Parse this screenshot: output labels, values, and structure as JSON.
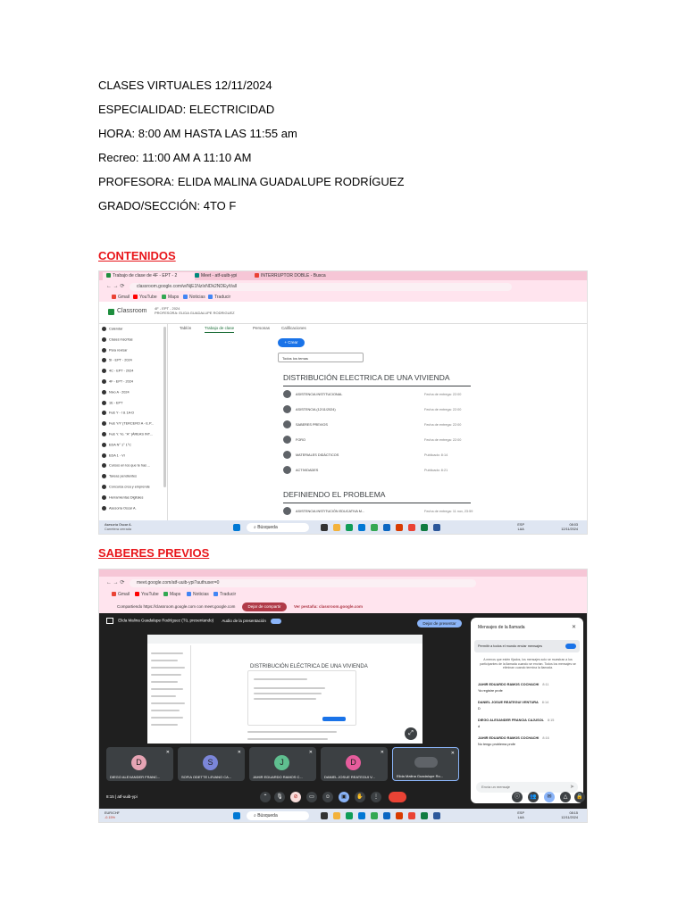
{
  "header": {
    "line1": "CLASES VIRTUALES 12/11/2024",
    "line2": "ESPECIALIDAD: ELECTRICIDAD",
    "line3": "HORA: 8:00 AM HASTA LAS 11:55 am",
    "line4": "Recreo: 11:00 AM A 11:10 AM",
    "line5": "PROFESORA: ELIDA MALINA GUADALUPE RODRÍGUEZ",
    "line6": "GRADO/SECCIÓN: 4TO F"
  },
  "sections": {
    "contenidos": "CONTENIDOS",
    "saberes": "SABERES PREVIOS"
  },
  "colors": {
    "section_heading": "#e8151a",
    "browser_frame": "#ffe4ee",
    "classroom_green": "#1e8e3e",
    "meet_dark": "#1f1f1f",
    "accent_blue": "#1a73e8"
  },
  "classroom": {
    "tabs": [
      "Trabajo de clase de 4F - EPT - 2",
      "Meet - atf-uuib-ypi",
      "INTERRUPTOR DOBLE - Busca"
    ],
    "url": "classroom.google.com/w/NjE1NzIxNDk2NDEy/t/all",
    "bookmarks": [
      "Gmail",
      "YouTube",
      "Maps",
      "Noticias",
      "Traducir"
    ],
    "app_name": "Classroom",
    "course": "4F - EPT - 2024",
    "teacher": "PROFESORA: ELIDA GUADALUPE RODRIGUEZ",
    "sidebar": [
      "Calendar",
      "Clases inscritas",
      "Para revisar",
      "5I - EPT - 2024",
      "4C - EPT - 2024",
      "4F - EPT - 2024",
      "Nivo A - 2024",
      "1E - EPT",
      "Fe& Y - I & 1A-D",
      "Fe& Y/Y (TERCERO A - E.P...",
      "Fe& Y. Yo. \"A\" (ÁREAS INT...",
      "EDA N° 1° 1°C",
      "EDA 1 - VI",
      "Cursos en los que te has ...",
      "Tareas pendientes",
      "Concursa crea y emprende",
      "Herramientas Digitales",
      "Asesoría Oscar A."
    ],
    "content_tabs": [
      "Tablón",
      "Trabajo de clase",
      "Personas",
      "Calificaciones"
    ],
    "create_label": "+ Crear",
    "topic_select": "Todos los temas",
    "topic1_title": "DISTRIBUCIÓN ELECTRICA DE UNA VIVIENDA",
    "topic1_items": [
      {
        "label": "ASISTENCIA INSTITUCIONAL",
        "meta": "Fecha de entrega: 22:00"
      },
      {
        "label": "ASISTENCIA (12/11/2024)",
        "meta": "Fecha de entrega: 22:00"
      },
      {
        "label": "SABERES PREVIOS",
        "meta": "Fecha de entrega: 22:00"
      },
      {
        "label": "FORO",
        "meta": "Fecha de entrega: 22:00"
      },
      {
        "label": "MATERIALES DIDÁCTICOS",
        "meta": "Publicado: 8:14"
      },
      {
        "label": "ACTIVIDADES",
        "meta": "Publicado: 8:21"
      }
    ],
    "topic2_title": "DEFINIENDO EL PROBLEMA",
    "topic2_items": [
      {
        "label": "ASISTENCIA INSTITUCIÓN EDUCATIVA M...",
        "meta": "Fecha de entrega: 11 nov, 23:59"
      }
    ],
    "taskbar": {
      "search": "Búsqueda",
      "lang1": "ESP",
      "lang2": "LAA",
      "time": "08:03",
      "date": "12/11/2024",
      "left_line1": "Asesoría Oscar A.",
      "left_line2": "Carretera cerrada"
    }
  },
  "meet": {
    "url": "meet.google.com/atf-uuib-ypi?authuser=0",
    "bookmarks": [
      "Gmail",
      "YouTube",
      "Maps",
      "Noticias",
      "Traducir"
    ],
    "share_text": "Compartiendo https://classroom.google.com con meet.google.com",
    "stop_share": "Dejar de compartir",
    "open_tab": "Ver pestaña: classroom.google.com",
    "presenter": "Elida Malina Guadalupe Rodríguez (Tú, presentando)",
    "audio": "Audio de la presentación",
    "stop_present": "Dejar de presentar",
    "mini_title": "DISTRIBUCIÓN ELÉCTRICA DE UNA VIVIENDA",
    "chat": {
      "title": "Mensajes de la llamada",
      "toggle": "Permitir a todos el mundo enviar mensajes",
      "info": "A menos que estén fijados, los mensajes solo se muestran a los participantes de la llamada cuando se envían. Todos los mensajes se eliminan cuando termina la llamada.",
      "messages": [
        {
          "name": "JAHIR EDUARDO RAMOS COCHACHI",
          "time": "8:11",
          "text": "Ya registre profe"
        },
        {
          "name": "DANIEL JOSUE REATEGUI VENTURA",
          "time": "8:14",
          "text": "D"
        },
        {
          "name": "DIEGO ALEXANDER FRANCIA CAJUSOL",
          "time": "8:15",
          "text": "d"
        },
        {
          "name": "JAHIR EDUARDO RAMOS COCHACHI",
          "time": "8:16",
          "text": "No tengo problema profe"
        }
      ],
      "input": "Envía un mensaje"
    },
    "tiles": [
      {
        "initial": "D",
        "name": "DIEGO ALEXANDER FRANC...",
        "color": "#e6a4b4"
      },
      {
        "initial": "S",
        "name": "SOFIA ODETTE LEVANO CA...",
        "color": "#7b86d9"
      },
      {
        "initial": "J",
        "name": "JAHIR EDUARDO RAMOS C...",
        "color": "#5fbf8f"
      },
      {
        "initial": "D",
        "name": "DANIEL JOSUE REATEGUI V...",
        "color": "#e65c9c"
      },
      {
        "initial": "",
        "name": "Elida Malina Guadalupe Ro...",
        "color": "#3c4043"
      }
    ],
    "time_code": "8:15 | atf-uuib-ypi",
    "taskbar": {
      "search": "Búsqueda",
      "lang1": "ESP",
      "lang2": "LAA",
      "time": "08:15",
      "date": "12/11/2024",
      "left_line1": "EUR/CHF",
      "left_line2": "-0.15%"
    }
  }
}
